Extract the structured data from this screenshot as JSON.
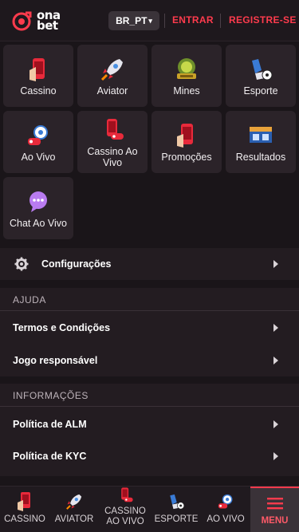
{
  "header": {
    "logo_line1": "ona",
    "logo_line2": "bet",
    "lang": "BR_PT",
    "login": "ENTRAR",
    "register": "REGISTRE-SE",
    "accent": "#ff3b4d"
  },
  "tiles": [
    {
      "label": "Cassino",
      "icon": "phone-cards-icon"
    },
    {
      "label": "Aviator",
      "icon": "rocket-icon"
    },
    {
      "label": "Mines",
      "icon": "mines-badge-icon"
    },
    {
      "label": "Esporte",
      "icon": "soccer-kick-icon"
    },
    {
      "label": "Ao Vivo",
      "icon": "live-soccer-icon"
    },
    {
      "label": "Cassino Ao Vivo",
      "icon": "live-casino-icon"
    },
    {
      "label": "Promoções",
      "icon": "promo-phone-icon"
    },
    {
      "label": "Resultados",
      "icon": "scoreboard-icon"
    },
    {
      "label": "Chat Ao Vivo",
      "icon": "chat-bubble-icon"
    }
  ],
  "settings": {
    "label": "Configurações"
  },
  "help": {
    "title": "AJUDA",
    "items": [
      "Termos e Condições",
      "Jogo responsável"
    ]
  },
  "info": {
    "title": "INFORMAÇÕES",
    "items": [
      "Política de ALM",
      "Política de KYC"
    ]
  },
  "nav": {
    "items": [
      "CASSINO",
      "AVIATOR",
      "CASSINO AO VIVO",
      "ESPORTE",
      "AO VIVO",
      "MENU"
    ],
    "active": "MENU"
  }
}
